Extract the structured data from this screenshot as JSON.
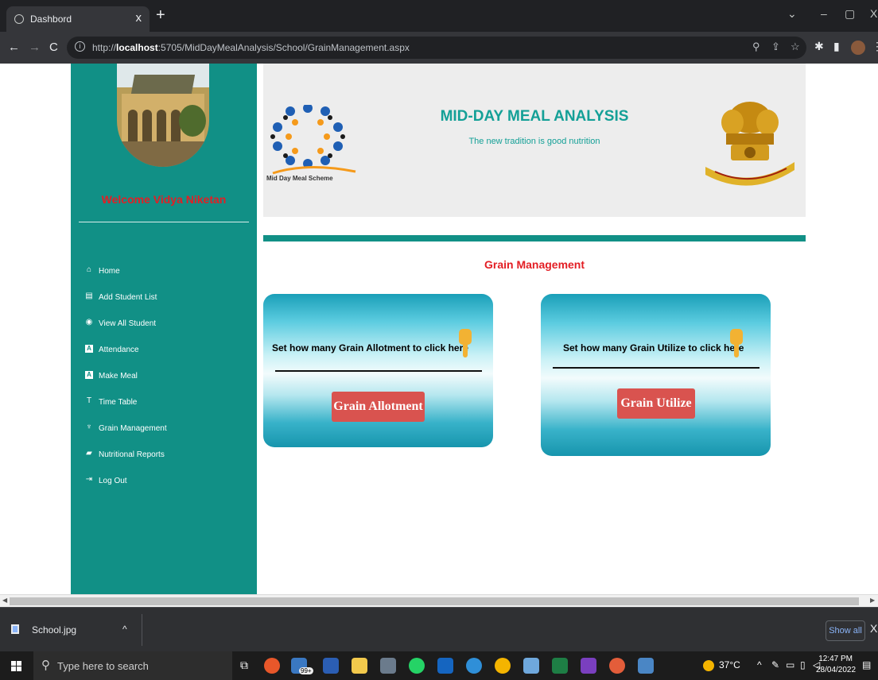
{
  "browser": {
    "tab_title": "Dashbord",
    "tab_close": "x",
    "new_tab": "+",
    "url_prefix": "http://",
    "url_host": "localhost",
    "url_rest": ":5705/MidDayMealAnalysis/School/GrainManagement.aspx",
    "nav": {
      "back": "←",
      "forward": "→",
      "reload": "C"
    },
    "window_controls": {
      "collapse": "⌄",
      "minimize": "–",
      "maximize": "▢",
      "close": "X"
    }
  },
  "sidebar": {
    "welcome": "Welcome Vidya Niketan",
    "items": [
      {
        "label": "Home",
        "icon": "home-icon"
      },
      {
        "label": "Add Student List",
        "icon": "add-list-icon"
      },
      {
        "label": "View All Student",
        "icon": "eye-icon"
      },
      {
        "label": "Attendance",
        "icon": "attendance-icon"
      },
      {
        "label": "Make Meal",
        "icon": "meal-icon"
      },
      {
        "label": "Time Table",
        "icon": "timetable-icon"
      },
      {
        "label": "Grain Management",
        "icon": "grain-icon"
      },
      {
        "label": "Nutritional Reports",
        "icon": "folder-icon"
      },
      {
        "label": "Log Out",
        "icon": "logout-icon"
      }
    ]
  },
  "banner": {
    "title": "MID-DAY MEAL ANALYSIS",
    "subtitle": "The new tradition is good nutrition",
    "logo_text": "Mid Day Meal Scheme"
  },
  "main": {
    "section_title": "Grain Management",
    "cards": [
      {
        "prompt": "Set how many Grain Allotment to click here",
        "button": "Grain Allotment"
      },
      {
        "prompt": "Set how many Grain Utilize to click here",
        "button": "Grain Utilize"
      }
    ]
  },
  "downloads": {
    "file_name": "School.jpg",
    "show_all": "Show all",
    "close": "X",
    "caret": "^"
  },
  "taskbar": {
    "search_placeholder": "Type here to search",
    "mail_badge": "99+",
    "temperature": "37°C",
    "time": "12:47 PM",
    "date": "28/04/2022"
  },
  "colors": {
    "sidebar": "#119086",
    "accent_red": "#e31e24",
    "banner_text": "#14a097",
    "button": "#d9534f"
  }
}
